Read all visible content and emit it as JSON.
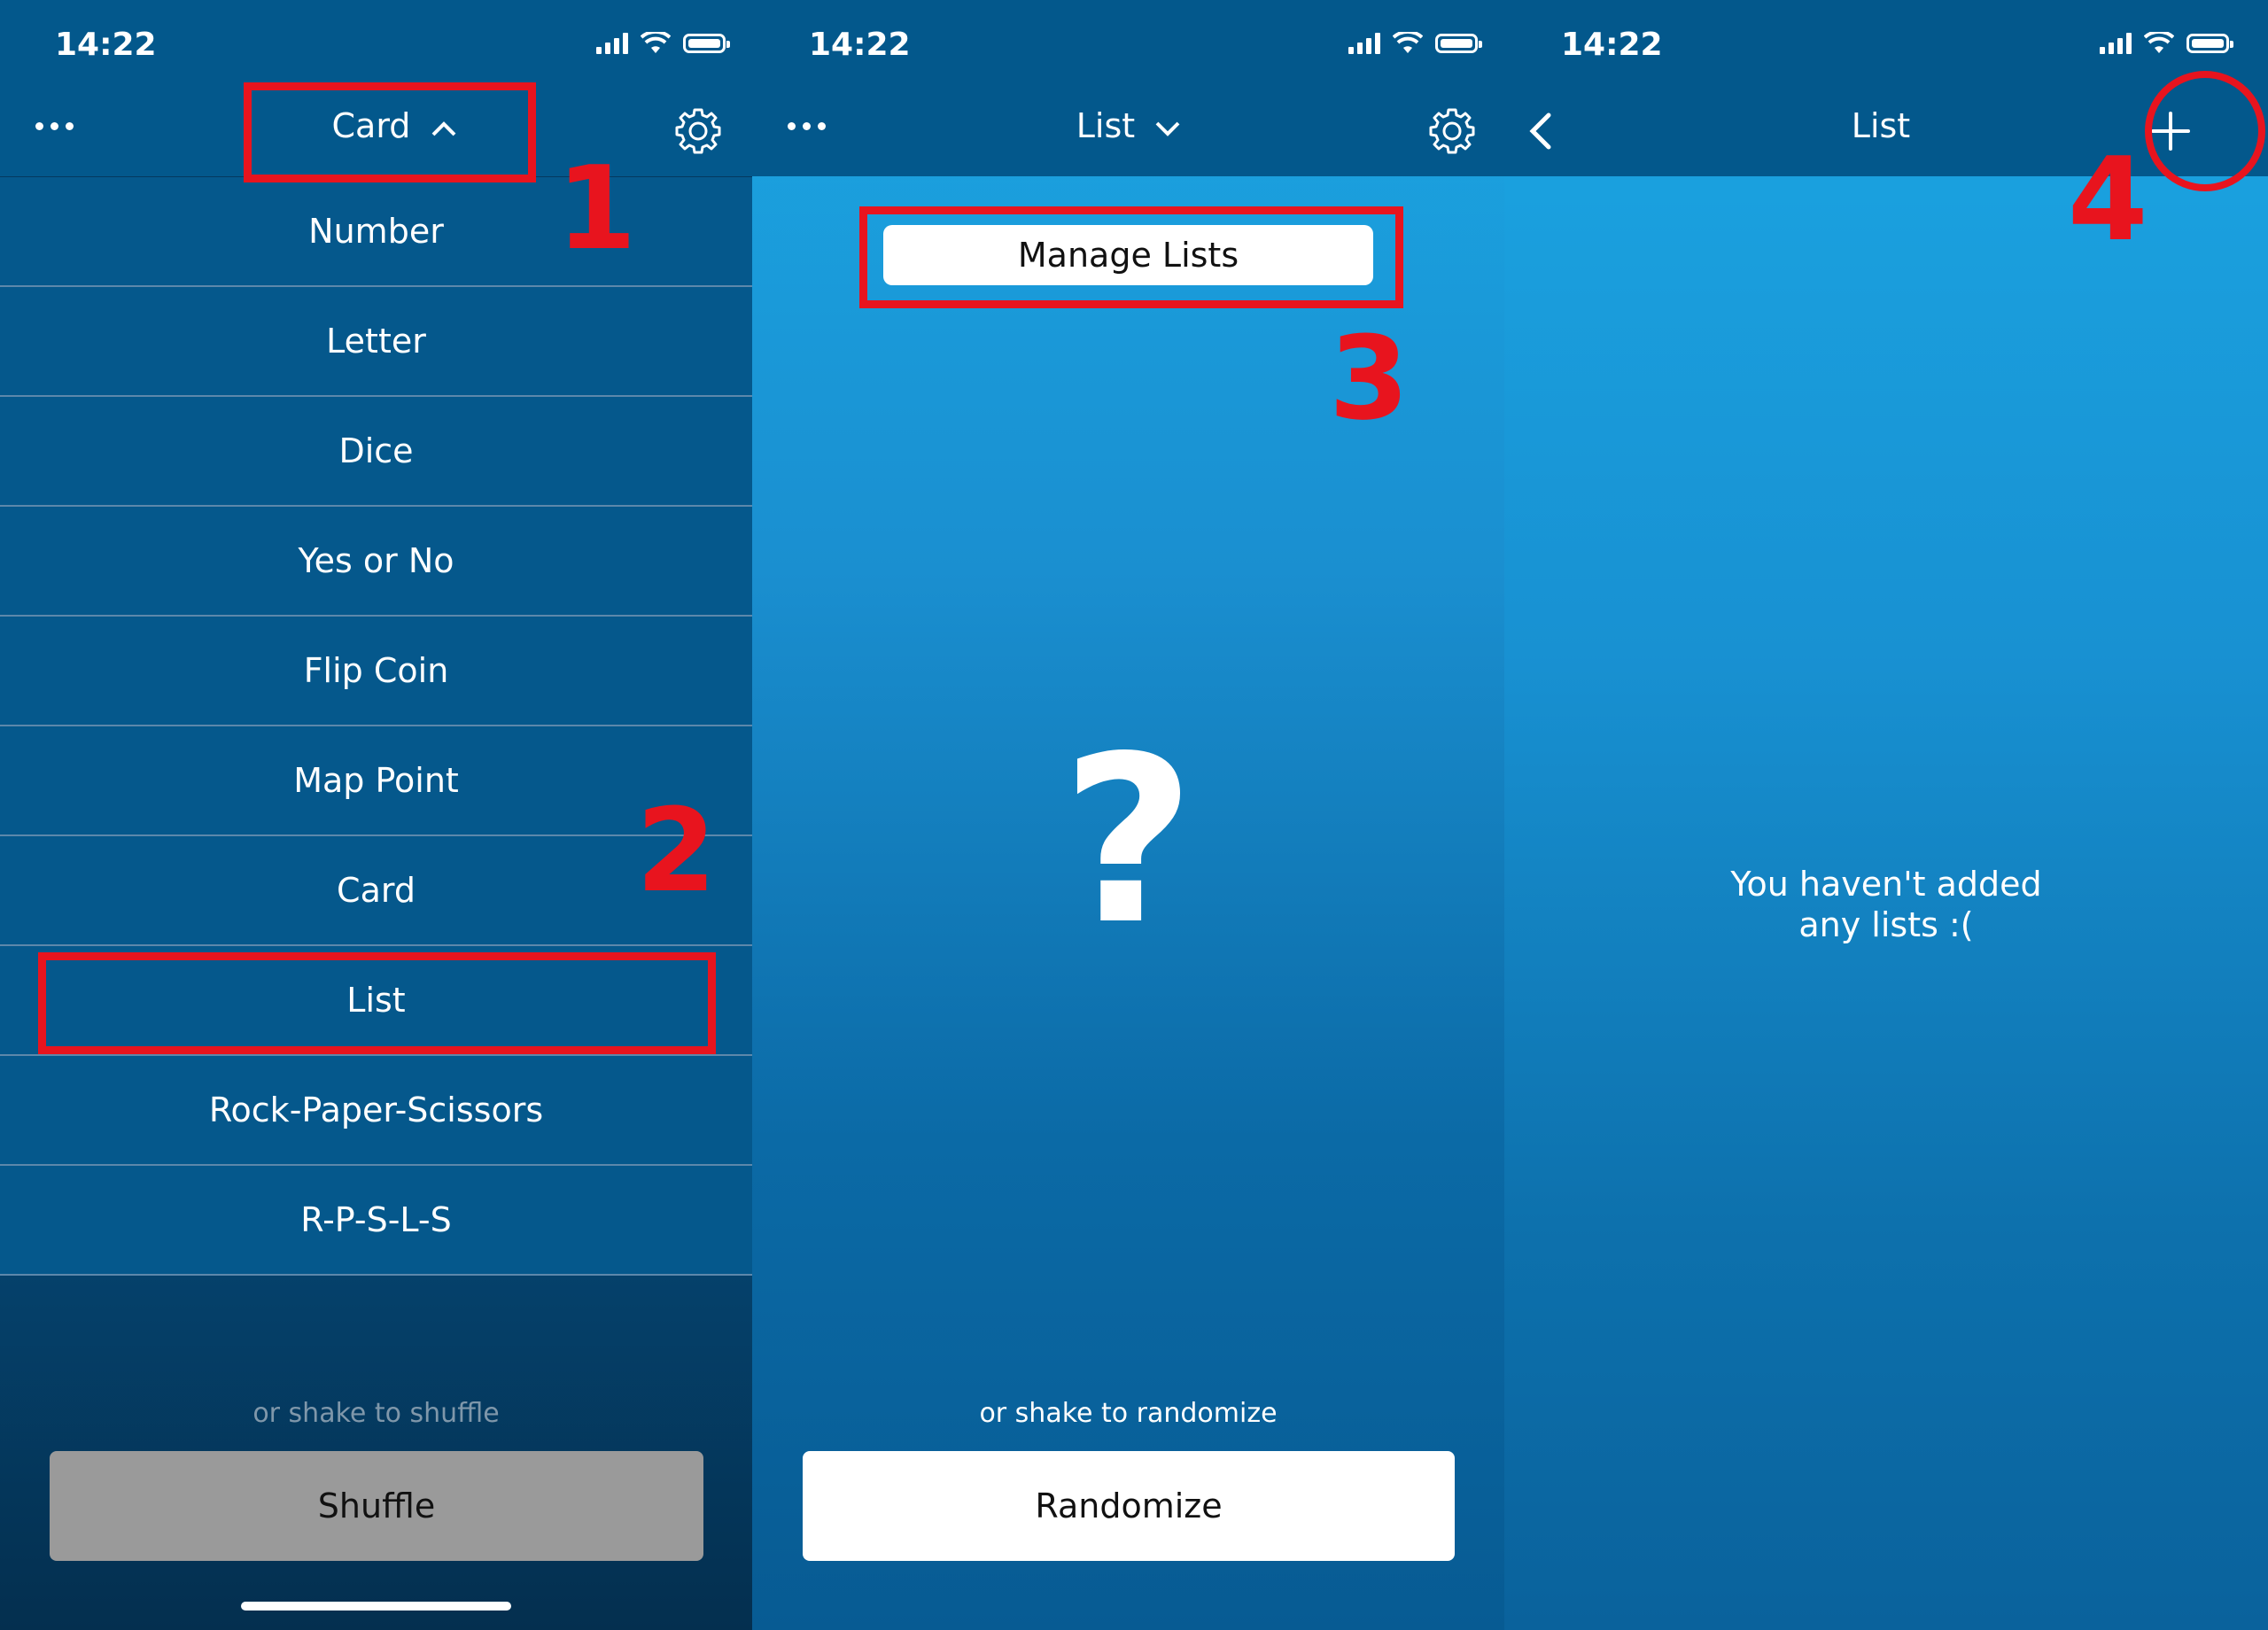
{
  "status": {
    "time": "14:22"
  },
  "panel1": {
    "title": "Card",
    "menu_items": [
      "Number",
      "Letter",
      "Dice",
      "Yes or No",
      "Flip Coin",
      "Map Point",
      "Card",
      "List",
      "Rock-Paper-Scissors",
      "R-P-S-L-S"
    ],
    "hint": "or shake to shuffle",
    "button": "Shuffle"
  },
  "panel2": {
    "title": "List",
    "manage_button": "Manage Lists",
    "placeholder_symbol": "?",
    "hint": "or shake to randomize",
    "button": "Randomize"
  },
  "panel3": {
    "title": "List",
    "empty_line1": "You haven't added",
    "empty_line2": "any lists :("
  },
  "annotations": [
    "1",
    "2",
    "3",
    "4"
  ],
  "colors": {
    "accent_red": "#e8141e",
    "nav_blue": "#03588c",
    "sky_blue": "#1ba6e3"
  }
}
